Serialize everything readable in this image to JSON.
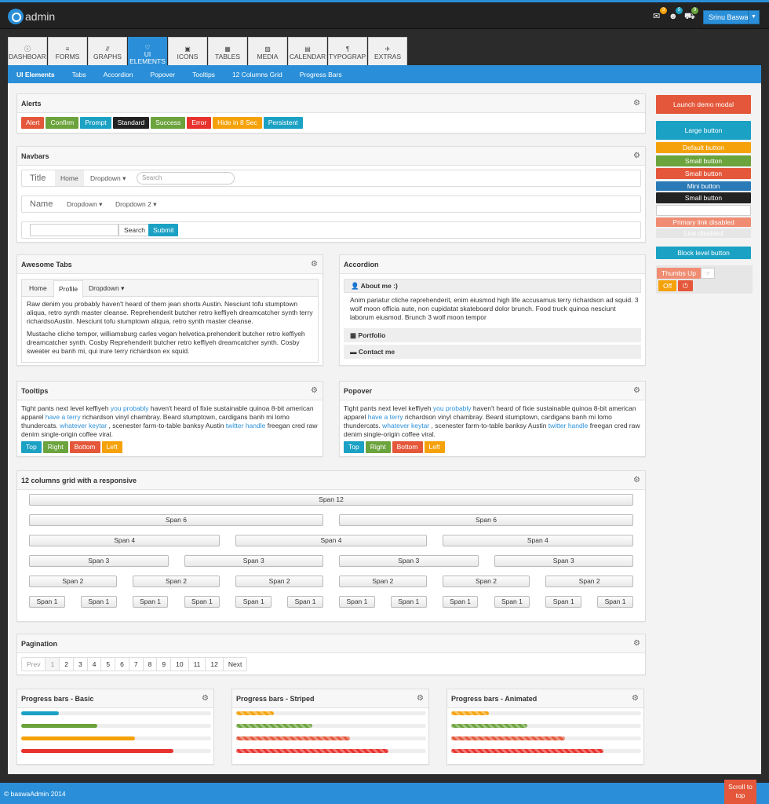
{
  "app": {
    "name": "admin"
  },
  "topbar": {
    "badges": [
      "3",
      "5",
      "9"
    ],
    "user": "Srinu Baswa"
  },
  "main_nav": [
    {
      "label": "DASHBOARD",
      "icon": "info-icon"
    },
    {
      "label": "FORMS",
      "icon": "list-icon"
    },
    {
      "label": "GRAPHS",
      "icon": "chart-icon"
    },
    {
      "label": "UI ELEMENTS",
      "icon": "heart-icon",
      "active": true
    },
    {
      "label": "ICONS",
      "icon": "briefcase-icon"
    },
    {
      "label": "TABLES",
      "icon": "table-icon"
    },
    {
      "label": "MEDIA",
      "icon": "image-icon"
    },
    {
      "label": "CALENDAR",
      "icon": "calendar-icon"
    },
    {
      "label": "TYPOGRAPHY",
      "icon": "text-icon"
    },
    {
      "label": "EXTRAS",
      "icon": "plane-icon"
    }
  ],
  "sub_nav": [
    "UI Elements",
    "Tabs",
    "Accordion",
    "Popover",
    "Tooltips",
    "12 Columns Grid",
    "Progress Bars"
  ],
  "alerts": {
    "title": "Alerts",
    "buttons": [
      "Alert",
      "Confirm",
      "Prompt",
      "Standard",
      "Success",
      "Error",
      "Hide in 8 Sec",
      "Persistent"
    ]
  },
  "navbars": {
    "title": "Navbars",
    "nb1": {
      "brand": "Title",
      "home": "Home",
      "dropdown": "Dropdown ▾",
      "search_placeholder": "Search"
    },
    "nb2": {
      "brand": "Name",
      "dropdown1": "Dropdown ▾",
      "dropdown2": "Dropdown 2 ▾"
    },
    "nb3": {
      "search": "Search",
      "submit": "Submit"
    }
  },
  "awesome_tabs": {
    "title": "Awesome Tabs",
    "tabs": [
      "Home",
      "Profile",
      "Dropdown ▾"
    ],
    "p1": "Raw denim you probably haven't heard of them jean shorts Austin. Nesciunt tofu stumptown aliqua, retro synth master cleanse. Reprehenderit butcher retro keffiyeh dreamcatcher synth terry richardsoAustin. Nesciunt tofu stumptown aliqua, retro synth master cleanse.",
    "p2": "Mustache cliche tempor, williamsburg carles vegan helvetica.prehenderit butcher retro keffiyeh dreamcatcher synth. Cosby Reprehenderit butcher retro keffiyeh dreamcatcher synth. Cosby sweater eu banh mi, qui irure terry richardson ex squid."
  },
  "accordion": {
    "title": "Accordion",
    "item1": "About me :)",
    "body": "Anim pariatur cliche reprehenderit, enim eiusmod high life accusamus terry richardson ad squid. 3 wolf moon officia aute, non cupidatat skateboard dolor brunch. Food truck quinoa nesciunt laborum eiusmod. Brunch 3 wolf moon tempor",
    "item2": "Portfolio",
    "item3": "Contact me"
  },
  "tooltips": {
    "title": "Tooltips",
    "t1": "Tight pants next level keffiyeh ",
    "l1": "you probably",
    "t2": " haven't heard of fixie sustainable quinoa 8-bit american apparel ",
    "l2": "have a terry",
    "t3": " richardson vinyl chambray. Beard stumptown, cardigans banh mi lomo thundercats. ",
    "l3": "whatever keytar",
    "t4": " , scenester farm-to-table banksy Austin ",
    "l4": "twitter handle",
    "t5": " freegan cred raw denim single-origin coffee viral.",
    "buttons": [
      "Top",
      "Right",
      "Bottom",
      "Left"
    ]
  },
  "popover": {
    "title": "Popover"
  },
  "grid": {
    "title": "12 columns grid with a responsive",
    "s12": "Span 12",
    "s6": "Span 6",
    "s4": "Span 4",
    "s3": "Span 3",
    "s2": "Span 2",
    "s1": "Span 1"
  },
  "pagination": {
    "title": "Pagination",
    "items": [
      "Prev",
      "1",
      "2",
      "3",
      "4",
      "5",
      "6",
      "7",
      "8",
      "9",
      "10",
      "11",
      "12",
      "Next"
    ]
  },
  "progress": {
    "basic_title": "Progress bars - Basic",
    "striped_title": "Progress bars - Striped",
    "animated_title": "Progress bars - Animated",
    "basic": [
      0.2,
      0.4,
      0.6,
      0.8
    ],
    "striped": [
      0.2,
      0.4,
      0.6,
      0.8
    ],
    "animated": [
      0.2,
      0.4,
      0.6,
      0.8
    ],
    "basic_colors": [
      "#1ba1c4",
      "#6ba33c",
      "#f5a20a",
      "#e8322e"
    ],
    "stripe_colors": [
      "#f5a20a",
      "#6ba33c",
      "#e4573a",
      "#e8322e"
    ]
  },
  "side": {
    "launch": "Launch demo modal",
    "large": "Large button",
    "default": "Default button",
    "small_green": "Small button",
    "small_red": "Small button",
    "mini": "Mini button",
    "small_black": "Small button",
    "small_white": "Small button",
    "primary_disabled": "Primary link disabled",
    "link_disabled": "Link disabled",
    "block": "Block level button",
    "thumbs": "Thumbs Up",
    "off": "Off"
  },
  "footer": {
    "copyright": "© baswaAdmin 2014",
    "scroll1": "Scroll to",
    "scroll2": "top"
  }
}
